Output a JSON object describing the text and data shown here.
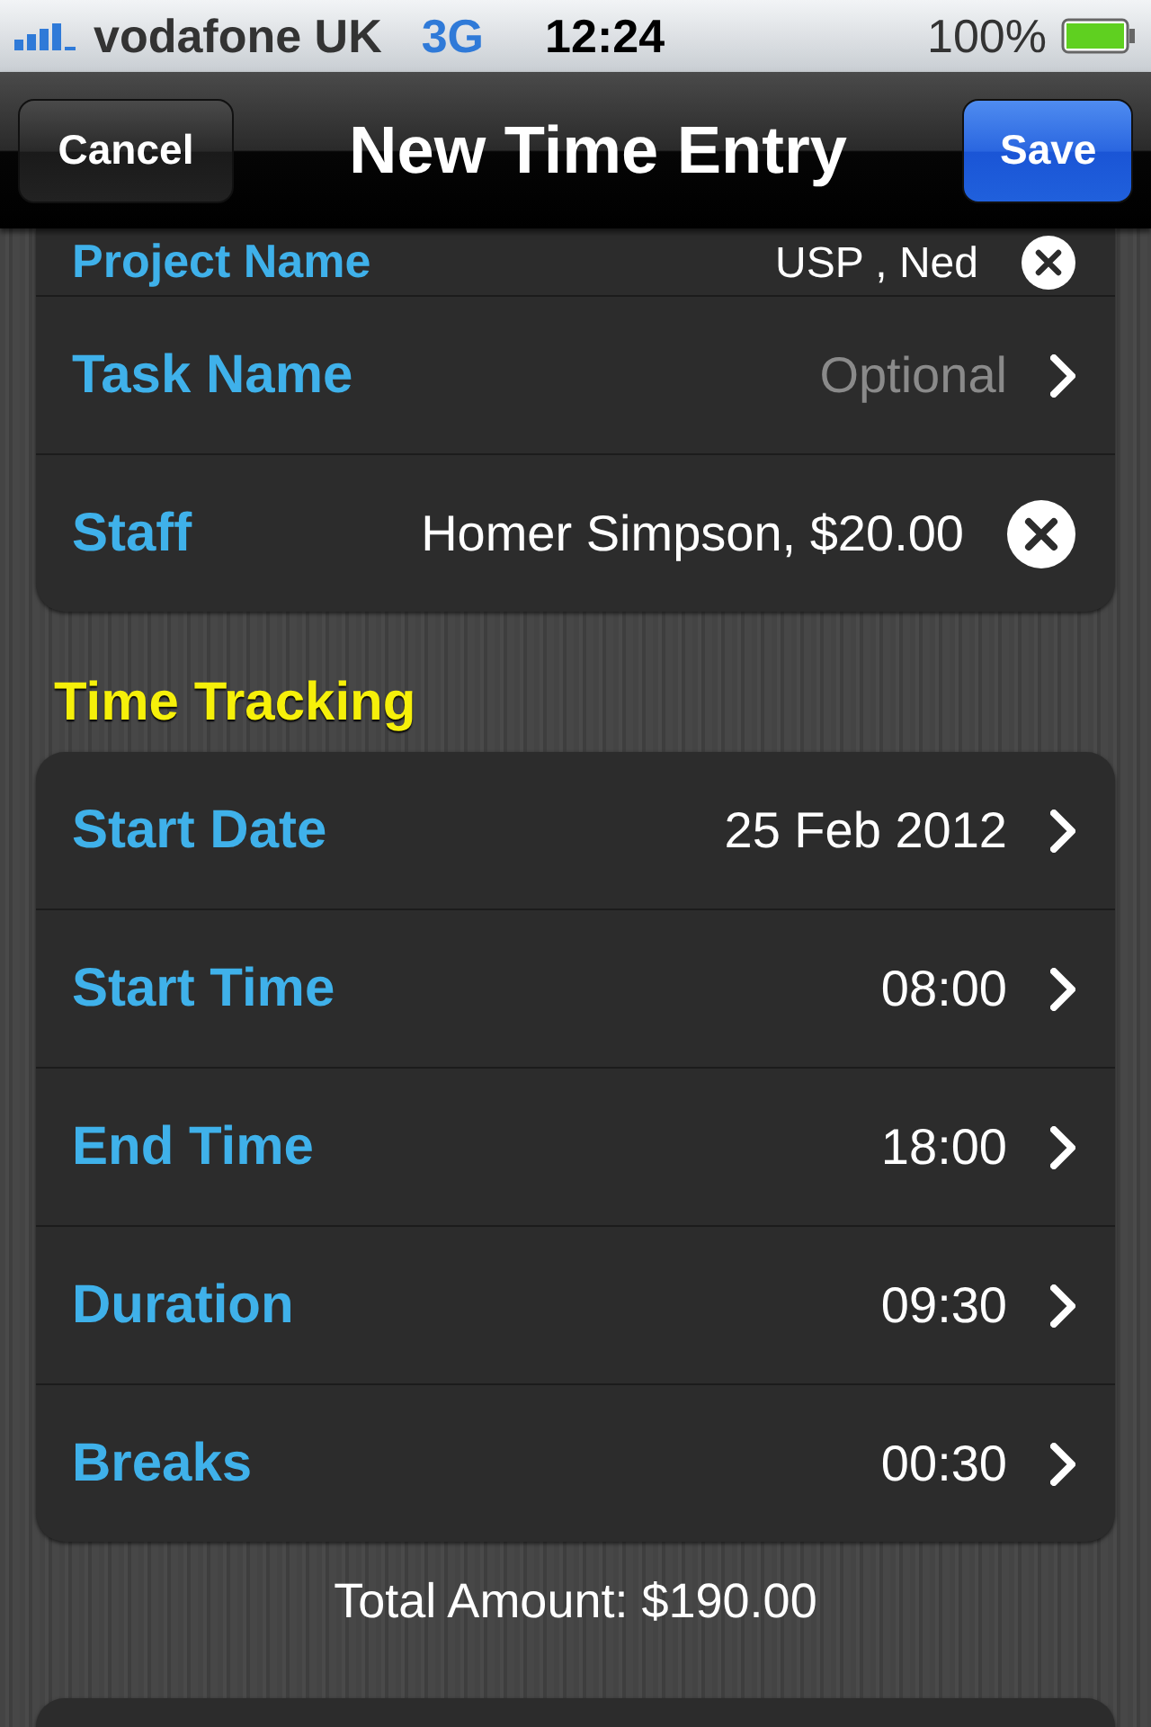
{
  "status_bar": {
    "carrier": "vodafone UK",
    "network": "3G",
    "time": "12:24",
    "battery": "100%"
  },
  "nav_bar": {
    "left_button": "Cancel",
    "title": "New Time Entry",
    "right_button": "Save"
  },
  "sections": [
    {
      "rows": [
        {
          "label": "Project Name",
          "value": "USP , Ned",
          "kind": "clear"
        },
        {
          "label": "Task Name",
          "placeholder": "Optional",
          "kind": "chevron"
        },
        {
          "label": "Staff",
          "value": "Homer Simpson, $20.00",
          "kind": "clear"
        }
      ]
    },
    {
      "header": "Time Tracking",
      "rows": [
        {
          "label": "Start Date",
          "value": "25 Feb 2012",
          "kind": "chevron"
        },
        {
          "label": "Start Time",
          "value": "08:00",
          "kind": "chevron"
        },
        {
          "label": "End Time",
          "value": "18:00",
          "kind": "chevron"
        },
        {
          "label": "Duration",
          "value": "09:30",
          "kind": "chevron"
        },
        {
          "label": "Breaks",
          "value": "00:30",
          "kind": "chevron"
        }
      ],
      "footer": "Total Amount: $190.00"
    }
  ]
}
